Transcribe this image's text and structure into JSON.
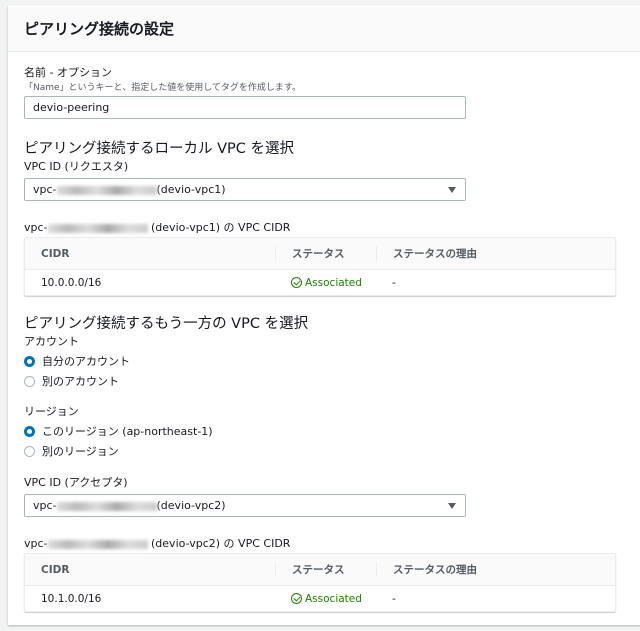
{
  "header": {
    "title": "ピアリング接続の設定"
  },
  "name": {
    "label": "名前 - オプション",
    "hint": "「Name」というキーと、指定した値を使用してタグを作成します。",
    "value": "devio-peering"
  },
  "local": {
    "heading": "ピアリング接続するローカル VPC を選択",
    "vpc_label": "VPC ID (リクエスタ)",
    "vpc_prefix": "vpc-",
    "vpc_name": "(devio-vpc1)",
    "cidr_prefix": "vpc-",
    "cidr_suffix": "(devio-vpc1) の VPC CIDR",
    "table": {
      "headers": [
        "CIDR",
        "ステータス",
        "ステータスの理由"
      ],
      "rows": [
        {
          "cidr": "10.0.0.0/16",
          "status": "Associated",
          "reason": "-"
        }
      ]
    }
  },
  "peer": {
    "heading": "ピアリング接続するもう一方の VPC を選択",
    "account_label": "アカウント",
    "accounts": [
      "自分のアカウント",
      "別のアカウント"
    ],
    "account_selected": 0,
    "region_label": "リージョン",
    "regions": [
      "このリージョン (ap-northeast-1)",
      "別のリージョン"
    ],
    "region_selected": 0,
    "vpc_label": "VPC ID (アクセプタ)",
    "vpc_prefix": "vpc-",
    "vpc_name": "(devio-vpc2)",
    "cidr_prefix": "vpc-",
    "cidr_suffix": "(devio-vpc2) の VPC CIDR",
    "table": {
      "headers": [
        "CIDR",
        "ステータス",
        "ステータスの理由"
      ],
      "rows": [
        {
          "cidr": "10.1.0.0/16",
          "status": "Associated",
          "reason": "-"
        }
      ]
    }
  },
  "colors": {
    "accent": "#0073bb",
    "success": "#1d8102"
  }
}
